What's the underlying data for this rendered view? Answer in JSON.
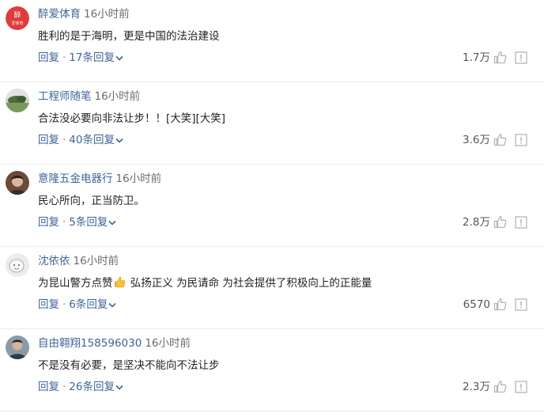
{
  "comments": [
    {
      "author": "醉爱体育",
      "time": "16小时前",
      "content": "胜利的是于海明，更是中国的法治建设",
      "reply_label": "回复",
      "replies_label": "17条回复",
      "likes": "1.7万",
      "avatar_icon": "zuiai-tiyu-logo",
      "avatar_text": "醉",
      "avatar_subtext": "爱体育",
      "avatar_color": "#e23b3b"
    },
    {
      "author": "工程师随笔",
      "time": "16小时前",
      "content": "合法没必要向非法让步！！[大笑][大笑]",
      "reply_label": "回复",
      "replies_label": "40条回复",
      "likes": "3.6万",
      "avatar_icon": "landscape-avatar"
    },
    {
      "author": "意隆五金电器行",
      "time": "16小时前",
      "content": "民心所向，正当防卫。",
      "reply_label": "回复",
      "replies_label": "5条回复",
      "likes": "2.8万",
      "avatar_icon": "portrait-avatar"
    },
    {
      "author": "沈依依",
      "time": "16小时前",
      "content_before": "为昆山警方点赞",
      "content_emoji": "thumbs-up-emoji",
      "content_after": " 弘扬正义 为民请命 为社会提供了积极向上的正能量",
      "reply_label": "回复",
      "replies_label": "6条回复",
      "likes": "6570",
      "avatar_icon": "sketch-avatar"
    },
    {
      "author": "自由翱翔158596030",
      "time": "16小时前",
      "content": "不是没有必要，是坚决不能向不法让步",
      "reply_label": "回复",
      "replies_label": "26条回复",
      "likes": "2.3万",
      "avatar_icon": "person-avatar"
    }
  ],
  "colors": {
    "author": "#406599",
    "time": "#6b6b6b",
    "content": "#222222",
    "link": "#406599",
    "icon": "#b5b5b5",
    "divider": "#ececec"
  }
}
